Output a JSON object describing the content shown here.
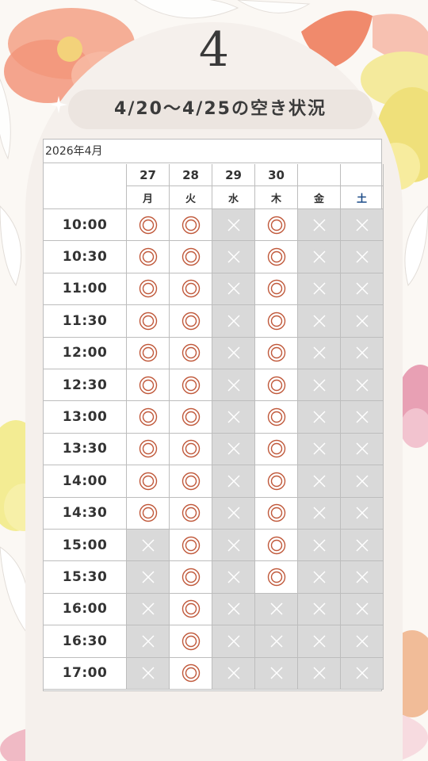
{
  "header": {
    "number": "4",
    "subtitle": "4/20〜4/25の空き状況"
  },
  "colors": {
    "available": "#c0583a",
    "closed_bg": "#d9d9d9",
    "saturday": "#1d4c88"
  },
  "icons": {
    "available": "double-circle-icon",
    "unavailable": "cross-icon",
    "sparkle": "sparkle-icon"
  },
  "calendar": {
    "month_label": "2026年4月",
    "dates": [
      "27",
      "28",
      "29",
      "30",
      "",
      ""
    ],
    "weekdays": [
      "月",
      "火",
      "水",
      "木",
      "金",
      "土"
    ],
    "times": [
      "10:00",
      "10:30",
      "11:00",
      "11:30",
      "12:00",
      "12:30",
      "13:00",
      "13:30",
      "14:00",
      "14:30",
      "15:00",
      "15:30",
      "16:00",
      "16:30",
      "17:00"
    ],
    "availability": [
      [
        1,
        1,
        0,
        1,
        0,
        0
      ],
      [
        1,
        1,
        0,
        1,
        0,
        0
      ],
      [
        1,
        1,
        0,
        1,
        0,
        0
      ],
      [
        1,
        1,
        0,
        1,
        0,
        0
      ],
      [
        1,
        1,
        0,
        1,
        0,
        0
      ],
      [
        1,
        1,
        0,
        1,
        0,
        0
      ],
      [
        1,
        1,
        0,
        1,
        0,
        0
      ],
      [
        1,
        1,
        0,
        1,
        0,
        0
      ],
      [
        1,
        1,
        0,
        1,
        0,
        0
      ],
      [
        1,
        1,
        0,
        1,
        0,
        0
      ],
      [
        0,
        1,
        0,
        1,
        0,
        0
      ],
      [
        0,
        1,
        0,
        1,
        0,
        0
      ],
      [
        0,
        1,
        0,
        0,
        0,
        0
      ],
      [
        0,
        1,
        0,
        0,
        0,
        0
      ],
      [
        0,
        1,
        0,
        0,
        0,
        0
      ]
    ]
  }
}
